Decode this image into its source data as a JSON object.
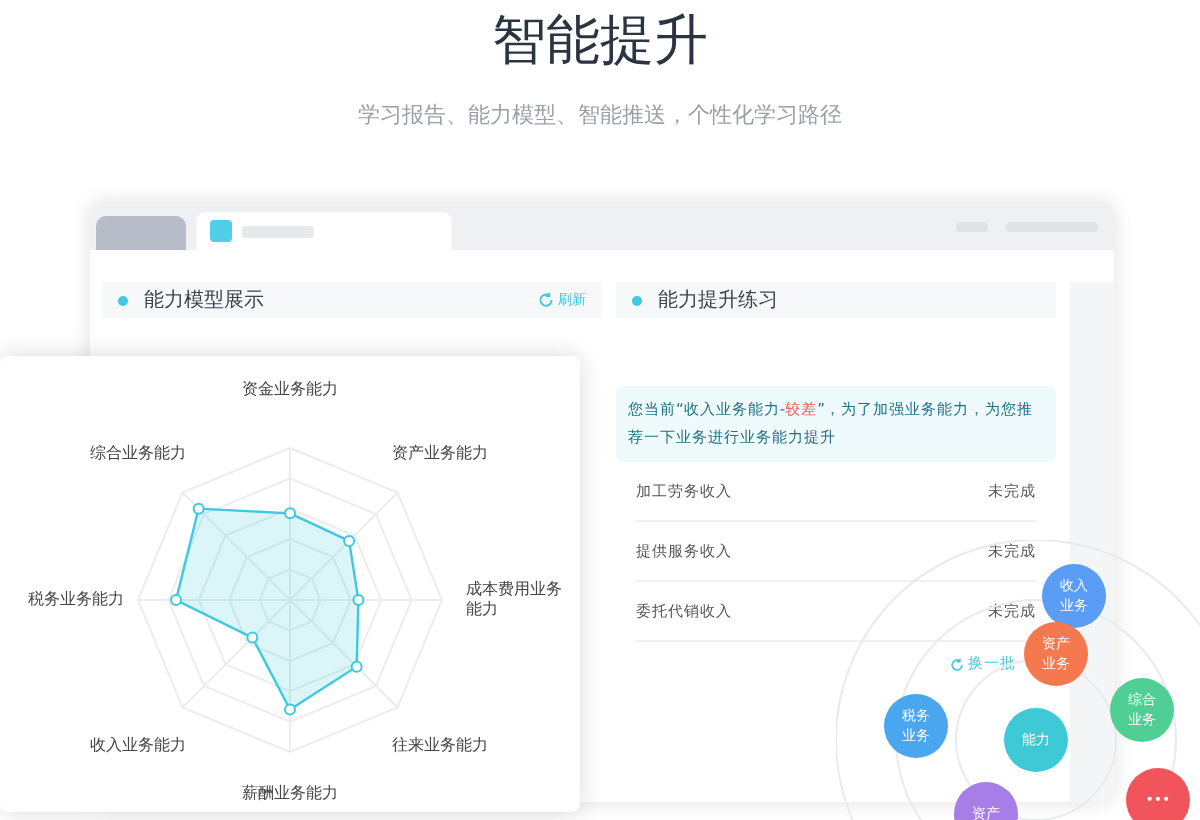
{
  "header": {
    "title": "智能提升",
    "subtitle": "学习报告、能力模型、智能推送，个性化学习路径"
  },
  "window": {
    "tabs": [
      {
        "selected": false
      },
      {
        "selected": true
      }
    ]
  },
  "left_panel": {
    "title": "能力模型展示",
    "refresh": "刷新"
  },
  "radar": {
    "axes": [
      "资金业务能力",
      "资产业务能力",
      "成本费用业务能力",
      "往来业务能力",
      "薪酬业务能力",
      "收入业务能力",
      "税务业务能力",
      "综合业务能力"
    ]
  },
  "right_panel": {
    "title": "能力提升练习",
    "notice": {
      "before": "您当前“收入业务能力-",
      "highlight": "较差",
      "after": "”，为了加强业务能力，为您推荐一下业务进行业务能力提升"
    },
    "rows": [
      {
        "name": "加工劳务收入",
        "status": "未完成"
      },
      {
        "name": "提供服务收入",
        "status": "未完成"
      },
      {
        "name": "委托代销收入",
        "status": "未完成"
      }
    ],
    "more": "换一批"
  },
  "bubbles": [
    {
      "label": "收入业务",
      "color": "#5b9cf5"
    },
    {
      "label": "资产业务",
      "color": "#f5784f"
    },
    {
      "label": "综合业务",
      "color": "#4fcf93"
    },
    {
      "label": "税务业务",
      "color": "#4ba6f0"
    },
    {
      "label": "能力",
      "color": "#3ec9d6"
    },
    {
      "label": "资产",
      "color": "#a77ee8"
    },
    {
      "label": "•••",
      "color": "#f2545b"
    }
  ]
}
